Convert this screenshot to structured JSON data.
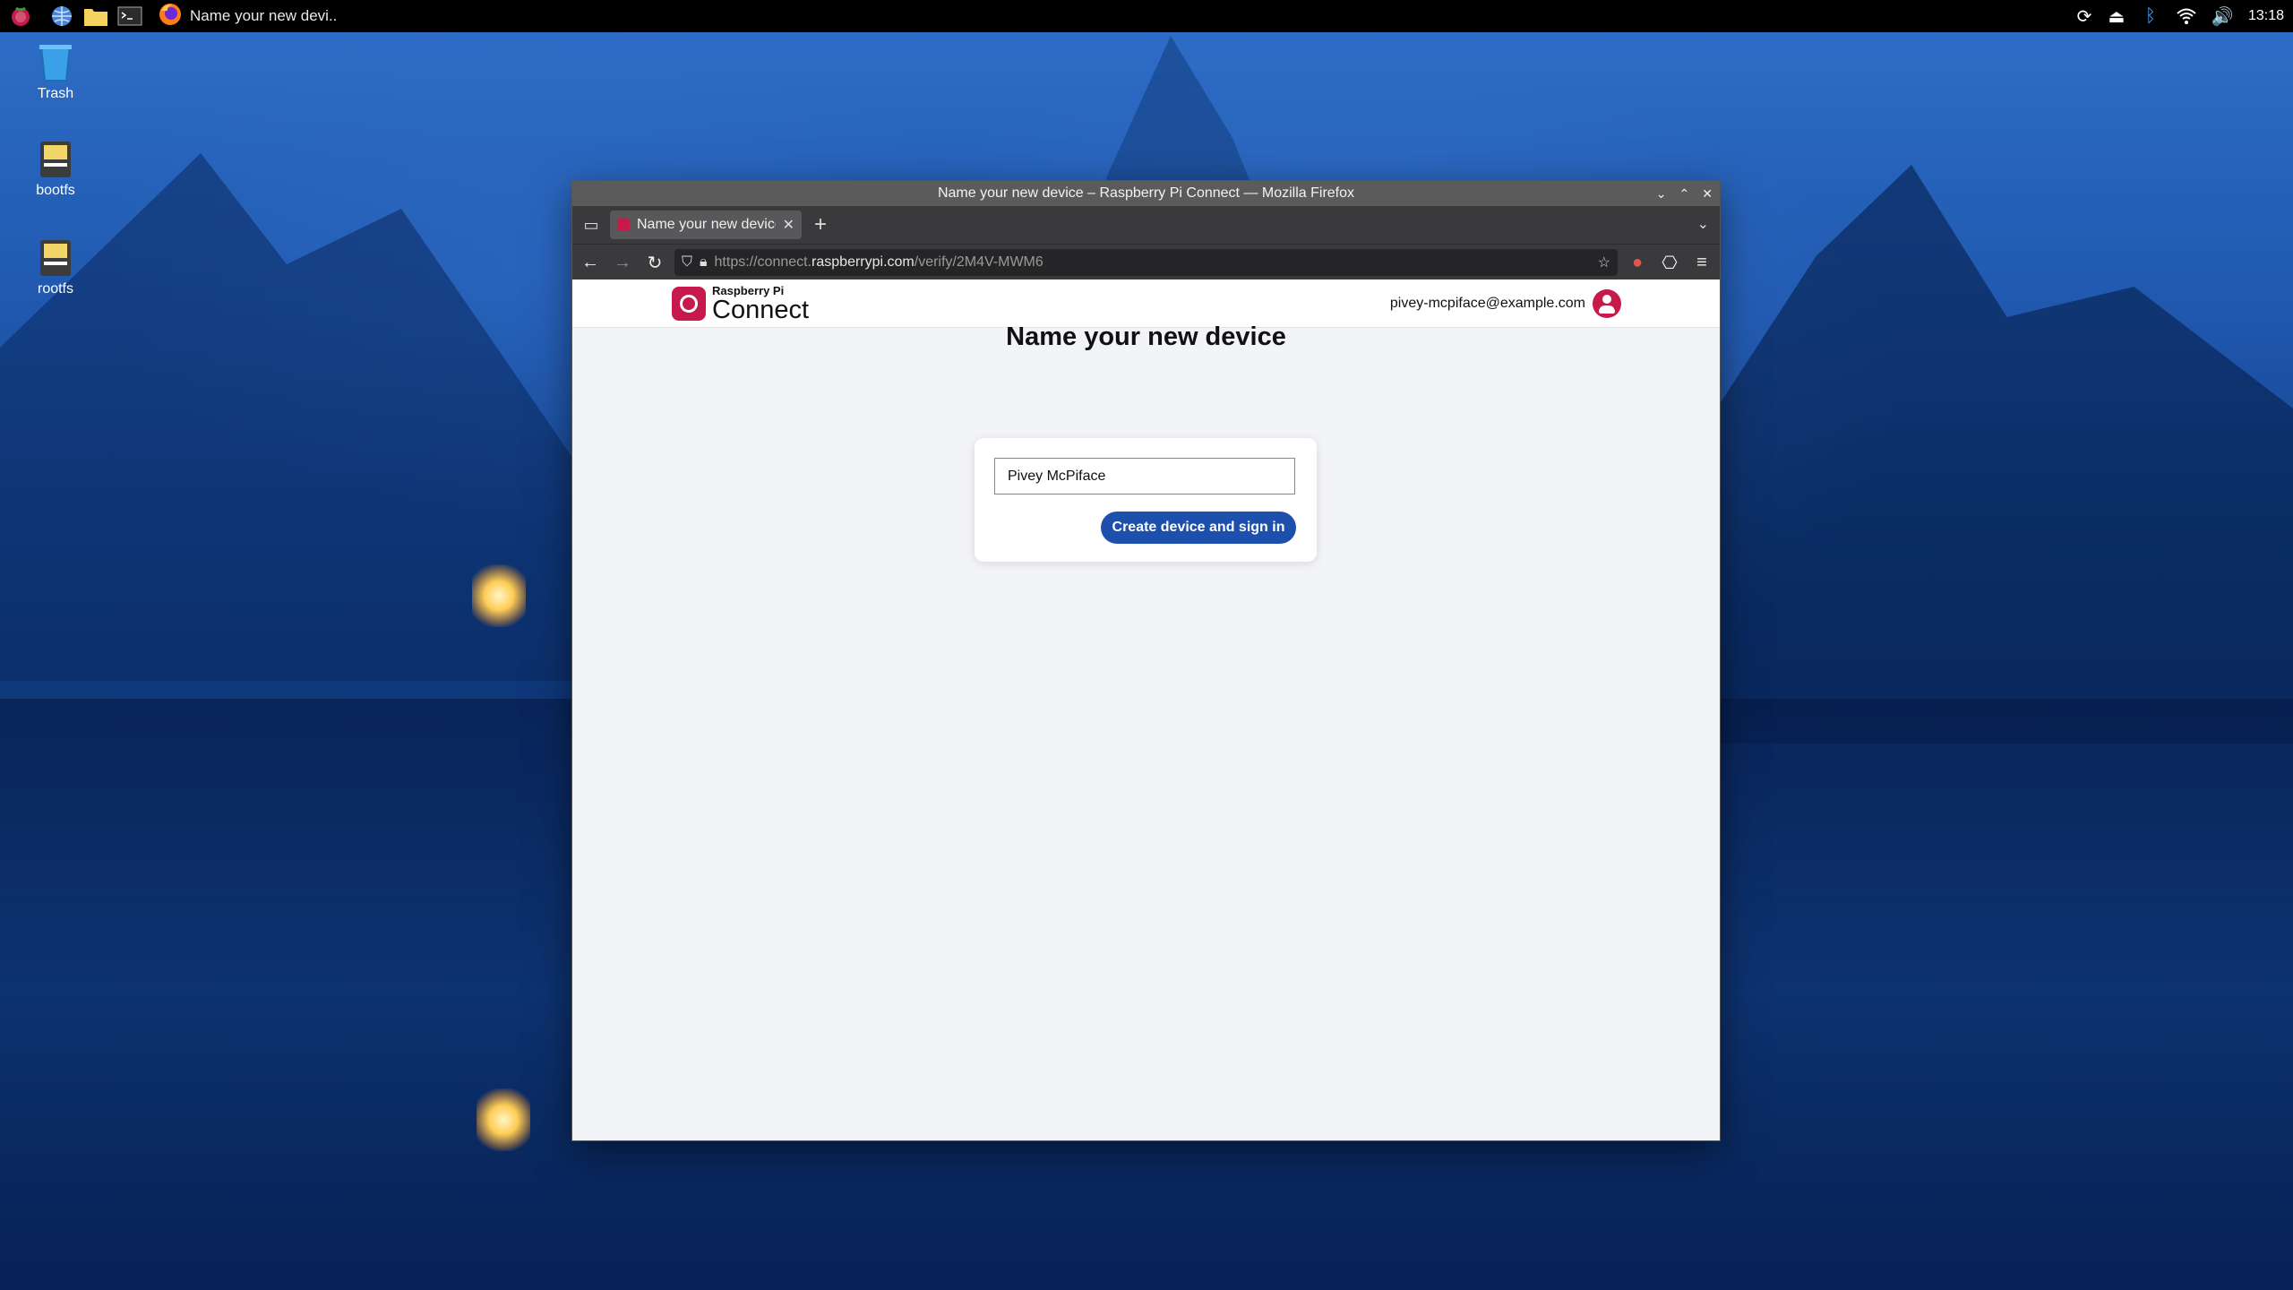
{
  "desktop": {
    "icons": [
      {
        "label": "Trash"
      },
      {
        "label": "bootfs"
      },
      {
        "label": "rootfs"
      }
    ]
  },
  "panel": {
    "task_title": "Name your new devi..",
    "clock": "13:18"
  },
  "window": {
    "title": "Name your new device – Raspberry Pi Connect — Mozilla Firefox",
    "tab_title": "Name your new device",
    "url_prefix": "https://connect.",
    "url_domain": "raspberrypi.com",
    "url_path": "/verify/2M4V-MWM6"
  },
  "site": {
    "brand_small": "Raspberry Pi",
    "brand_big": "Connect",
    "account_email": "pivey-mcpiface@example.com"
  },
  "main": {
    "heading": "Name your new device",
    "device_name_value": "Pivey McPiface",
    "submit_label": "Create device and sign in"
  },
  "colors": {
    "brand": "#c51a4a",
    "button": "#1d4fad"
  }
}
